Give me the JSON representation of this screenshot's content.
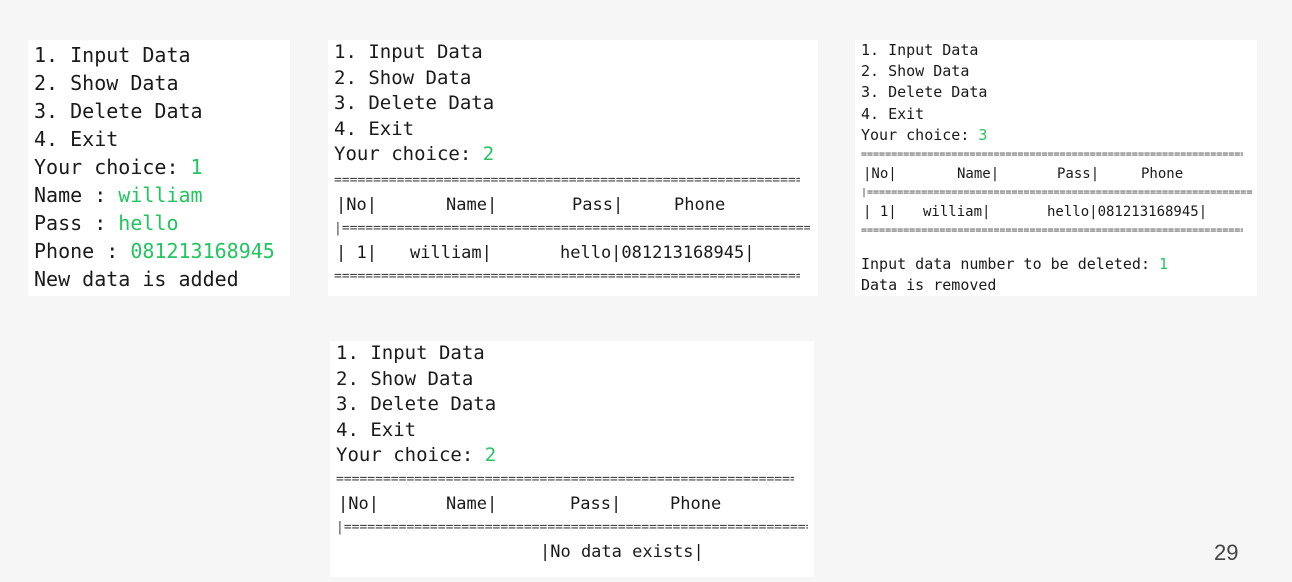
{
  "menu": {
    "item1": "1. Input Data",
    "item2": "2. Show Data",
    "item3": "3. Delete Data",
    "item4": "4. Exit",
    "choice_prompt": "Your choice: "
  },
  "panel1": {
    "choice": "1",
    "name_label": "Name : ",
    "name_value": "william",
    "pass_label": "Pass : ",
    "pass_value": "hello",
    "phone_label": "Phone : ",
    "phone_value": "081213168945",
    "result": "New data is added"
  },
  "panel2": {
    "choice": "2",
    "headers": [
      "|No|",
      "Name|",
      "Pass|",
      "Phone"
    ],
    "row": {
      "no": "| 1|",
      "name": "william|",
      "pass_phone": "hello|081213168945|"
    }
  },
  "panel3": {
    "choice": "3",
    "headers": [
      "|No|",
      "Name|",
      "Pass|",
      "Phone"
    ],
    "row": {
      "no": "| 1|",
      "name": "william|",
      "pass_phone": "hello|081213168945|"
    },
    "delete_prompt": "Input data number to be deleted: ",
    "delete_value": "1",
    "result": "Data is removed"
  },
  "panel4": {
    "choice": "2",
    "headers": [
      "|No|",
      "Name|",
      "Pass|",
      "Phone"
    ],
    "empty_message": "|No data exists|"
  },
  "page_number": "29",
  "colors": {
    "input_text": "#22c55e",
    "background": "#f6f6f6",
    "panel": "#ffffff"
  }
}
